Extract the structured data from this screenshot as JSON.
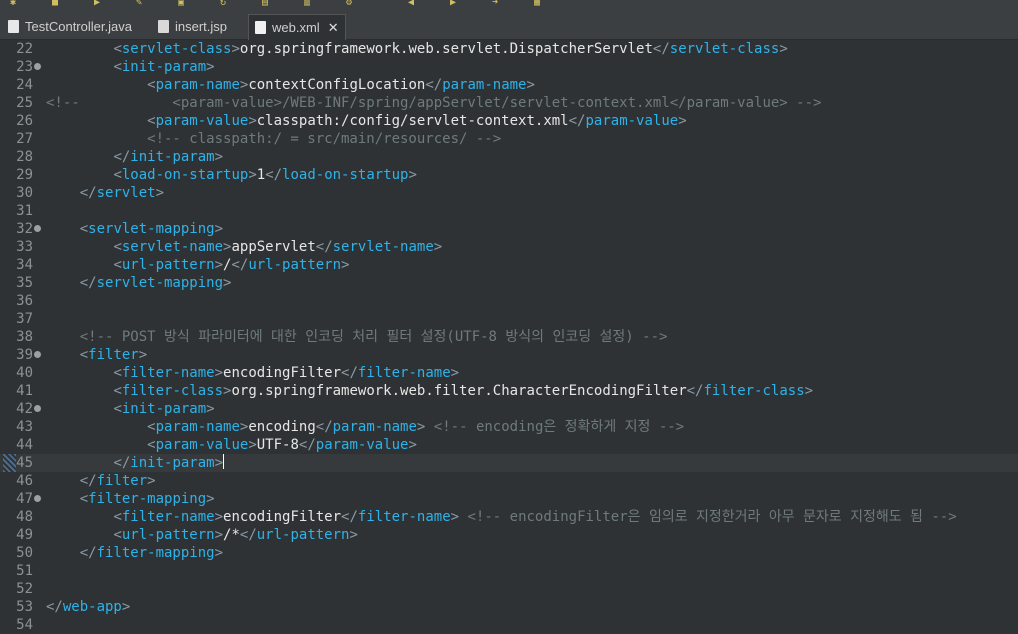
{
  "toolbar": {
    "icons": [
      "debug-icon",
      "stop-icon",
      "run-icon",
      "new-file-icon",
      "save-icon",
      "refresh-icon",
      "open-icon",
      "folder-icon",
      "search-icon",
      "back-icon",
      "forward-icon",
      "nav-icon",
      "pin-icon"
    ]
  },
  "tabs": [
    {
      "label": "TestController.java",
      "icon": "java-file-icon",
      "active": false
    },
    {
      "label": "insert.jsp",
      "icon": "jsp-file-icon",
      "active": false
    },
    {
      "label": "web.xml",
      "icon": "xml-file-icon",
      "active": true,
      "close": "✕"
    }
  ],
  "editor": {
    "current_line": "45",
    "lines": [
      {
        "n": "22",
        "fold": false,
        "segs": [
          [
            "x",
            "        "
          ],
          [
            "b",
            "<"
          ],
          [
            "t",
            "servlet-class"
          ],
          [
            "b",
            ">"
          ],
          [
            "x",
            "org.springframework.web.servlet.DispatcherServlet"
          ],
          [
            "b",
            "</"
          ],
          [
            "t",
            "servlet-class"
          ],
          [
            "b",
            ">"
          ]
        ]
      },
      {
        "n": "23",
        "fold": true,
        "segs": [
          [
            "x",
            "        "
          ],
          [
            "b",
            "<"
          ],
          [
            "t",
            "init-param"
          ],
          [
            "b",
            ">"
          ]
        ]
      },
      {
        "n": "24",
        "fold": false,
        "segs": [
          [
            "x",
            "            "
          ],
          [
            "b",
            "<"
          ],
          [
            "t",
            "param-name"
          ],
          [
            "b",
            ">"
          ],
          [
            "x",
            "contextConfigLocation"
          ],
          [
            "b",
            "</"
          ],
          [
            "t",
            "param-name"
          ],
          [
            "b",
            ">"
          ]
        ]
      },
      {
        "n": "25",
        "fold": false,
        "segs": [
          [
            "c",
            "<!--           <param-value>/WEB-INF/spring/appServlet/servlet-context.xml</param-value> -->"
          ]
        ]
      },
      {
        "n": "26",
        "fold": false,
        "segs": [
          [
            "x",
            "            "
          ],
          [
            "b",
            "<"
          ],
          [
            "t",
            "param-value"
          ],
          [
            "b",
            ">"
          ],
          [
            "x",
            "classpath:/config/servlet-context.xml"
          ],
          [
            "b",
            "</"
          ],
          [
            "t",
            "param-value"
          ],
          [
            "b",
            ">"
          ]
        ]
      },
      {
        "n": "27",
        "fold": false,
        "segs": [
          [
            "c",
            "            <!-- classpath:/ = src/main/resources/ -->"
          ]
        ]
      },
      {
        "n": "28",
        "fold": false,
        "segs": [
          [
            "x",
            "        "
          ],
          [
            "b",
            "</"
          ],
          [
            "t",
            "init-param"
          ],
          [
            "b",
            ">"
          ]
        ]
      },
      {
        "n": "29",
        "fold": false,
        "segs": [
          [
            "x",
            "        "
          ],
          [
            "b",
            "<"
          ],
          [
            "t",
            "load-on-startup"
          ],
          [
            "b",
            ">"
          ],
          [
            "x",
            "1"
          ],
          [
            "b",
            "</"
          ],
          [
            "t",
            "load-on-startup"
          ],
          [
            "b",
            ">"
          ]
        ]
      },
      {
        "n": "30",
        "fold": false,
        "segs": [
          [
            "x",
            "    "
          ],
          [
            "b",
            "</"
          ],
          [
            "t",
            "servlet"
          ],
          [
            "b",
            ">"
          ]
        ]
      },
      {
        "n": "31",
        "fold": false,
        "segs": []
      },
      {
        "n": "32",
        "fold": true,
        "segs": [
          [
            "x",
            "    "
          ],
          [
            "b",
            "<"
          ],
          [
            "t",
            "servlet-mapping"
          ],
          [
            "b",
            ">"
          ]
        ]
      },
      {
        "n": "33",
        "fold": false,
        "segs": [
          [
            "x",
            "        "
          ],
          [
            "b",
            "<"
          ],
          [
            "t",
            "servlet-name"
          ],
          [
            "b",
            ">"
          ],
          [
            "x",
            "appServlet"
          ],
          [
            "b",
            "</"
          ],
          [
            "t",
            "servlet-name"
          ],
          [
            "b",
            ">"
          ]
        ]
      },
      {
        "n": "34",
        "fold": false,
        "segs": [
          [
            "x",
            "        "
          ],
          [
            "b",
            "<"
          ],
          [
            "t",
            "url-pattern"
          ],
          [
            "b",
            ">"
          ],
          [
            "x",
            "/"
          ],
          [
            "b",
            "</"
          ],
          [
            "t",
            "url-pattern"
          ],
          [
            "b",
            ">"
          ]
        ]
      },
      {
        "n": "35",
        "fold": false,
        "segs": [
          [
            "x",
            "    "
          ],
          [
            "b",
            "</"
          ],
          [
            "t",
            "servlet-mapping"
          ],
          [
            "b",
            ">"
          ]
        ]
      },
      {
        "n": "36",
        "fold": false,
        "segs": []
      },
      {
        "n": "37",
        "fold": false,
        "segs": []
      },
      {
        "n": "38",
        "fold": false,
        "segs": [
          [
            "c",
            "    <!-- POST 방식 파라미터에 대한 인코딩 처리 필터 설정(UTF-8 방식의 인코딩 설정) -->"
          ]
        ]
      },
      {
        "n": "39",
        "fold": true,
        "segs": [
          [
            "x",
            "    "
          ],
          [
            "b",
            "<"
          ],
          [
            "t",
            "filter"
          ],
          [
            "b",
            ">"
          ]
        ]
      },
      {
        "n": "40",
        "fold": false,
        "segs": [
          [
            "x",
            "        "
          ],
          [
            "b",
            "<"
          ],
          [
            "t",
            "filter-name"
          ],
          [
            "b",
            ">"
          ],
          [
            "x",
            "encodingFilter"
          ],
          [
            "b",
            "</"
          ],
          [
            "t",
            "filter-name"
          ],
          [
            "b",
            ">"
          ]
        ]
      },
      {
        "n": "41",
        "fold": false,
        "segs": [
          [
            "x",
            "        "
          ],
          [
            "b",
            "<"
          ],
          [
            "t",
            "filter-class"
          ],
          [
            "b",
            ">"
          ],
          [
            "x",
            "org.springframework.web.filter.CharacterEncodingFilter"
          ],
          [
            "b",
            "</"
          ],
          [
            "t",
            "filter-class"
          ],
          [
            "b",
            ">"
          ]
        ]
      },
      {
        "n": "42",
        "fold": true,
        "segs": [
          [
            "x",
            "        "
          ],
          [
            "b",
            "<"
          ],
          [
            "t",
            "init-param"
          ],
          [
            "b",
            ">"
          ]
        ]
      },
      {
        "n": "43",
        "fold": false,
        "segs": [
          [
            "x",
            "            "
          ],
          [
            "b",
            "<"
          ],
          [
            "t",
            "param-name"
          ],
          [
            "b",
            ">"
          ],
          [
            "x",
            "encoding"
          ],
          [
            "b",
            "</"
          ],
          [
            "t",
            "param-name"
          ],
          [
            "b",
            ">"
          ],
          [
            "x",
            " "
          ],
          [
            "c",
            "<!-- encoding은 정확하게 지정 -->"
          ]
        ]
      },
      {
        "n": "44",
        "fold": false,
        "segs": [
          [
            "x",
            "            "
          ],
          [
            "b",
            "<"
          ],
          [
            "t",
            "param-value"
          ],
          [
            "b",
            ">"
          ],
          [
            "x",
            "UTF-8"
          ],
          [
            "b",
            "</"
          ],
          [
            "t",
            "param-value"
          ],
          [
            "b",
            ">"
          ]
        ]
      },
      {
        "n": "45",
        "fold": false,
        "segs": [
          [
            "x",
            "        "
          ],
          [
            "b",
            "</"
          ],
          [
            "t",
            "init-param"
          ],
          [
            "b",
            ">"
          ]
        ]
      },
      {
        "n": "46",
        "fold": false,
        "segs": [
          [
            "x",
            "    "
          ],
          [
            "b",
            "</"
          ],
          [
            "t",
            "filter"
          ],
          [
            "b",
            ">"
          ]
        ]
      },
      {
        "n": "47",
        "fold": true,
        "segs": [
          [
            "x",
            "    "
          ],
          [
            "b",
            "<"
          ],
          [
            "t",
            "filter-mapping"
          ],
          [
            "b",
            ">"
          ]
        ]
      },
      {
        "n": "48",
        "fold": false,
        "segs": [
          [
            "x",
            "        "
          ],
          [
            "b",
            "<"
          ],
          [
            "t",
            "filter-name"
          ],
          [
            "b",
            ">"
          ],
          [
            "x",
            "encodingFilter"
          ],
          [
            "b",
            "</"
          ],
          [
            "t",
            "filter-name"
          ],
          [
            "b",
            ">"
          ],
          [
            "x",
            " "
          ],
          [
            "c",
            "<!-- encodingFilter은 임의로 지정한거라 아무 문자로 지정해도 됨 -->"
          ]
        ]
      },
      {
        "n": "49",
        "fold": false,
        "segs": [
          [
            "x",
            "        "
          ],
          [
            "b",
            "<"
          ],
          [
            "t",
            "url-pattern"
          ],
          [
            "b",
            ">"
          ],
          [
            "x",
            "/*"
          ],
          [
            "b",
            "</"
          ],
          [
            "t",
            "url-pattern"
          ],
          [
            "b",
            ">"
          ]
        ]
      },
      {
        "n": "50",
        "fold": false,
        "segs": [
          [
            "x",
            "    "
          ],
          [
            "b",
            "</"
          ],
          [
            "t",
            "filter-mapping"
          ],
          [
            "b",
            ">"
          ]
        ]
      },
      {
        "n": "51",
        "fold": false,
        "segs": []
      },
      {
        "n": "52",
        "fold": false,
        "segs": []
      },
      {
        "n": "53",
        "fold": false,
        "segs": [
          [
            "b",
            "</"
          ],
          [
            "t",
            "web-app"
          ],
          [
            "b",
            ">"
          ]
        ]
      },
      {
        "n": "54",
        "fold": false,
        "segs": []
      }
    ]
  }
}
